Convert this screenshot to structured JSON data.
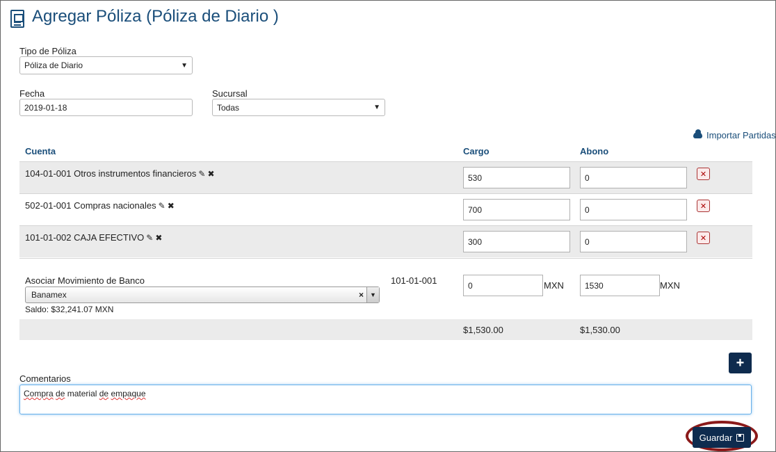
{
  "header": {
    "title": "Agregar Póliza (Póliza de Diario )",
    "icon": "document-icon"
  },
  "form": {
    "tipo_label": "Tipo de Póliza",
    "tipo_value": "Póliza de Diario",
    "fecha_label": "Fecha",
    "fecha_value": "2019-01-18",
    "sucursal_label": "Sucursal",
    "sucursal_value": "Todas"
  },
  "import_link": "Importar Partidas",
  "table": {
    "headers": {
      "cuenta": "Cuenta",
      "cargo": "Cargo",
      "abono": "Abono"
    },
    "rows": [
      {
        "cuenta": "104-01-001 Otros instrumentos financieros",
        "cargo": "530",
        "abono": "0"
      },
      {
        "cuenta": "502-01-001 Compras nacionales",
        "cargo": "700",
        "abono": "0"
      },
      {
        "cuenta": "101-01-002 CAJA EFECTIVO",
        "cargo": "300",
        "abono": "0"
      }
    ]
  },
  "bank": {
    "label": "Asociar Movimiento de Banco",
    "selected": "Banamex",
    "clear": "×",
    "saldo": "Saldo: $32,241.07 MXN",
    "account": "101-01-001",
    "cargo": "0",
    "abono": "1530",
    "currency": "MXN"
  },
  "totals": {
    "cargo": "$1,530.00",
    "abono": "$1,530.00"
  },
  "comments": {
    "label": "Comentarios",
    "words": [
      "Compra",
      " ",
      "de",
      " material ",
      "de",
      " ",
      "empaque"
    ]
  },
  "buttons": {
    "add": "+",
    "save": "Guardar"
  },
  "colors": {
    "primary": "#1a4e7a",
    "button": "#0e2b4e",
    "highlight": "#8b1a1a",
    "danger": "#aa0000"
  }
}
